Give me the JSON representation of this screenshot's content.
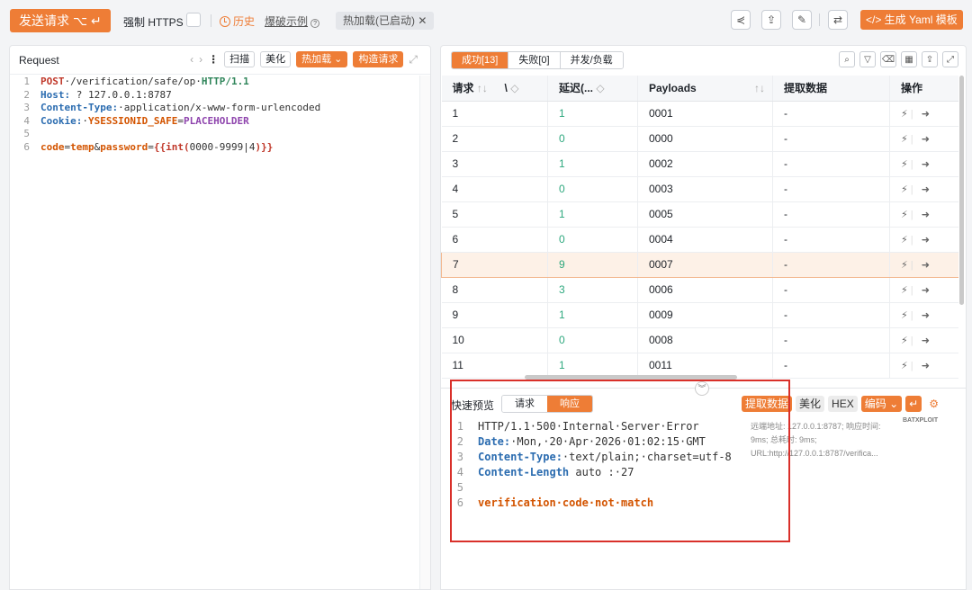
{
  "toolbar": {
    "send_label": "发送请求",
    "send_shortcut": "⌥ ↵",
    "force_https": "强制 HTTPS",
    "history": "历史",
    "example": "爆破示例",
    "hotload_tag": "热加载(已启动)",
    "yaml_button": "</> 生成 Yaml 模板"
  },
  "request": {
    "title": "Request",
    "btn_scan": "扫描",
    "btn_beautify": "美化",
    "btn_hotload": "热加载",
    "btn_construct": "构造请求",
    "lines": [
      {
        "n": "1",
        "parts": [
          [
            "POST",
            "k-red"
          ],
          [
            "·/verification/safe/op·",
            "k-dark"
          ],
          [
            "HTTP/1.1",
            "k-green"
          ]
        ]
      },
      {
        "n": "2",
        "parts": [
          [
            "Host:",
            "k-blue"
          ],
          [
            " ",
            "k-dark"
          ],
          [
            "?",
            "k-dark"
          ],
          [
            " 127.0.0.1:8787",
            "k-dark"
          ]
        ]
      },
      {
        "n": "3",
        "parts": [
          [
            "Content-Type:",
            "k-blue"
          ],
          [
            "·application/x-www-form-urlencoded",
            "k-dark"
          ]
        ]
      },
      {
        "n": "4",
        "parts": [
          [
            "Cookie:",
            "k-blue"
          ],
          [
            "·",
            "k-dark"
          ],
          [
            "YSESSIONID_SAFE",
            "k-orange"
          ],
          [
            "=",
            "k-dark"
          ],
          [
            "PLACEHOLDER",
            "k-purple"
          ]
        ]
      },
      {
        "n": "5",
        "parts": []
      },
      {
        "n": "6",
        "parts": [
          [
            "code",
            "k-orange"
          ],
          [
            "=",
            "k-dark"
          ],
          [
            "temp",
            "k-orange"
          ],
          [
            "&",
            "k-dark"
          ],
          [
            "password",
            "k-orange"
          ],
          [
            "=",
            "k-dark"
          ],
          [
            "{{int(",
            "k-red"
          ],
          [
            "0000-9999|4",
            "k-dark"
          ],
          [
            ")}}",
            "k-red"
          ]
        ]
      }
    ]
  },
  "results": {
    "tab_success": "成功[13]",
    "tab_fail": "失败[0]",
    "tab_concurrency": "并发/负载",
    "columns": [
      "请求",
      "\\",
      "延迟(...",
      "Payloads",
      "提取数据",
      "操作"
    ],
    "rows": [
      {
        "req": "1",
        "delay": "1",
        "payload": "0001",
        "extract": "-"
      },
      {
        "req": "2",
        "delay": "0",
        "payload": "0000",
        "extract": "-"
      },
      {
        "req": "3",
        "delay": "1",
        "payload": "0002",
        "extract": "-"
      },
      {
        "req": "4",
        "delay": "0",
        "payload": "0003",
        "extract": "-"
      },
      {
        "req": "5",
        "delay": "1",
        "payload": "0005",
        "extract": "-"
      },
      {
        "req": "6",
        "delay": "0",
        "payload": "0004",
        "extract": "-"
      },
      {
        "req": "7",
        "delay": "9",
        "payload": "0007",
        "extract": "-"
      },
      {
        "req": "8",
        "delay": "3",
        "payload": "0006",
        "extract": "-"
      },
      {
        "req": "9",
        "delay": "1",
        "payload": "0009",
        "extract": "-"
      },
      {
        "req": "10",
        "delay": "0",
        "payload": "0008",
        "extract": "-"
      },
      {
        "req": "11",
        "delay": "1",
        "payload": "0011",
        "extract": "-"
      }
    ]
  },
  "preview": {
    "label": "快速预览",
    "tab_request": "请求",
    "tab_response": "响应",
    "btn_extract": "提取数据",
    "btn_beautify": "美化",
    "btn_hex": "HEX",
    "btn_encode": "编码",
    "meta": "远端地址: 127.0.0.1:8787; 响应时间: 9ms; 总耗时: 9ms; URL:http://127.0.0.1:8787/verifica...",
    "logo": "BATXPLOIT",
    "lines": [
      {
        "n": "1",
        "parts": [
          [
            "HTTP/1.1·500·Internal·Server·Error",
            "k-dark"
          ]
        ]
      },
      {
        "n": "2",
        "parts": [
          [
            "Date:",
            "k-blue"
          ],
          [
            "·Mon,·20·Apr·2026·01:02:15·GMT",
            "k-dark"
          ]
        ]
      },
      {
        "n": "3",
        "parts": [
          [
            "Content-Type:",
            "k-blue"
          ],
          [
            "·text/plain;·charset=utf-8",
            "k-dark"
          ]
        ]
      },
      {
        "n": "4",
        "parts": [
          [
            "Content-Length",
            "k-blue"
          ],
          [
            " auto ",
            "k-dark"
          ],
          [
            ":·27",
            "k-dark"
          ]
        ]
      },
      {
        "n": "5",
        "parts": []
      },
      {
        "n": "6",
        "parts": [
          [
            "verification·code·not·match",
            "k-orange"
          ]
        ]
      }
    ]
  },
  "colors": {
    "accent": "#ee7d36",
    "highlight_row": "#fdf1e7",
    "delay_green": "#2ea87e",
    "annotation_red": "#d9302a"
  }
}
